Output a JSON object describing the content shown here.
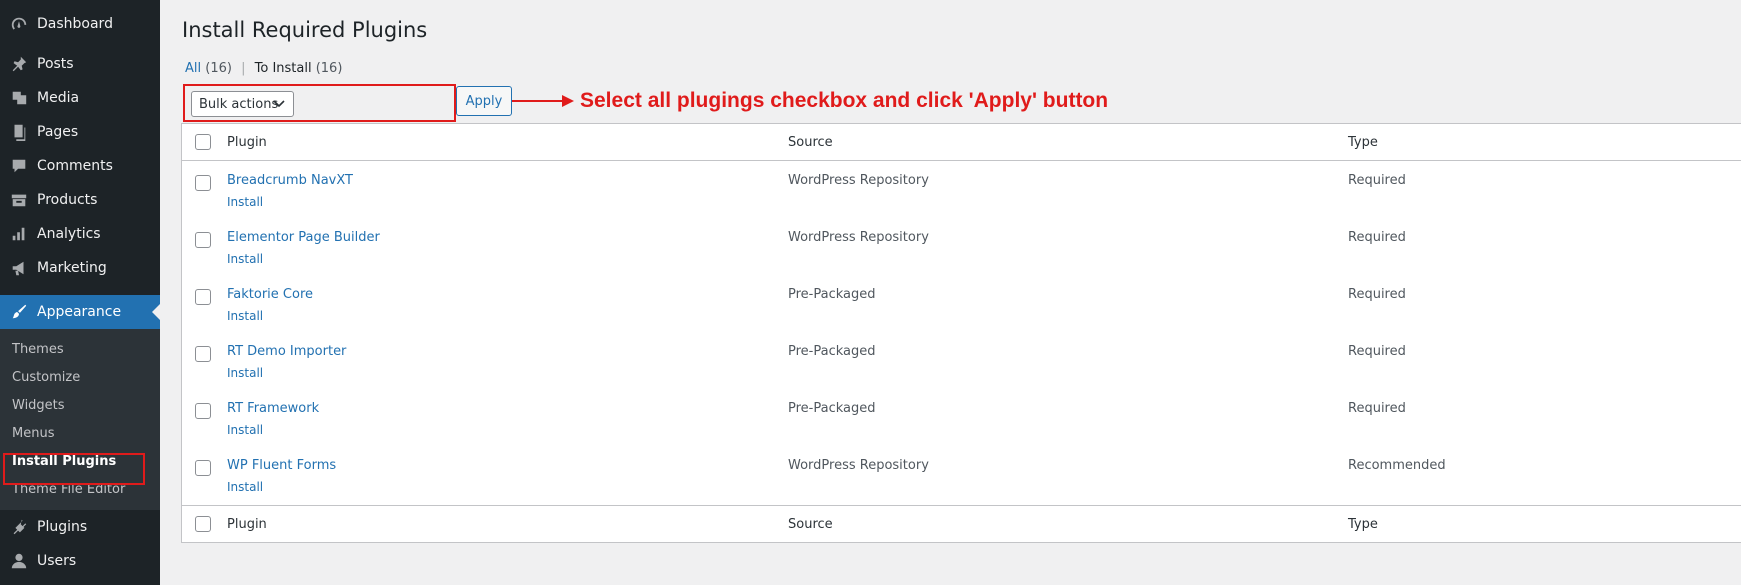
{
  "sidebar": {
    "menu": [
      {
        "label": "Dashboard",
        "icon": "dashboard-icon"
      },
      {
        "label": "Posts",
        "icon": "pin-icon"
      },
      {
        "label": "Media",
        "icon": "media-icon"
      },
      {
        "label": "Pages",
        "icon": "pages-icon"
      },
      {
        "label": "Comments",
        "icon": "comment-icon"
      },
      {
        "label": "Products",
        "icon": "archive-icon"
      },
      {
        "label": "Analytics",
        "icon": "bar-chart-icon"
      },
      {
        "label": "Marketing",
        "icon": "megaphone-icon"
      }
    ],
    "current": {
      "label": "Appearance",
      "icon": "paintbrush-icon"
    },
    "submenu": [
      "Themes",
      "Customize",
      "Widgets",
      "Menus",
      "Install Plugins",
      "Theme File Editor"
    ],
    "after": [
      {
        "label": "Plugins",
        "icon": "plugin-icon"
      },
      {
        "label": "Users",
        "icon": "user-icon"
      }
    ]
  },
  "page": {
    "title": "Install Required Plugins",
    "filters": {
      "all_label": "All",
      "all_count": "(16)",
      "install_label": "To Install",
      "install_count": "(16)",
      "separator": "|"
    },
    "bulk_actions": "Bulk actions",
    "apply": "Apply",
    "annotation": "Select all plugings checkbox and click 'Apply' button",
    "annotation_color": "#e01b1b"
  },
  "table": {
    "headers": {
      "plugin": "Plugin",
      "source": "Source",
      "type": "Type"
    },
    "install_label": "Install",
    "rows": [
      {
        "name": "Breadcrumb NavXT",
        "source": "WordPress Repository",
        "type": "Required"
      },
      {
        "name": "Elementor Page Builder",
        "source": "WordPress Repository",
        "type": "Required"
      },
      {
        "name": "Faktorie Core",
        "source": "Pre-Packaged",
        "type": "Required"
      },
      {
        "name": "RT Demo Importer",
        "source": "Pre-Packaged",
        "type": "Required"
      },
      {
        "name": "RT Framework",
        "source": "Pre-Packaged",
        "type": "Required"
      },
      {
        "name": "WP Fluent Forms",
        "source": "WordPress Repository",
        "type": "Recommended"
      }
    ]
  },
  "colors": {
    "sidebar_bg": "#1d2327",
    "accent": "#2271b1",
    "submenu_bg": "#2c3338"
  }
}
